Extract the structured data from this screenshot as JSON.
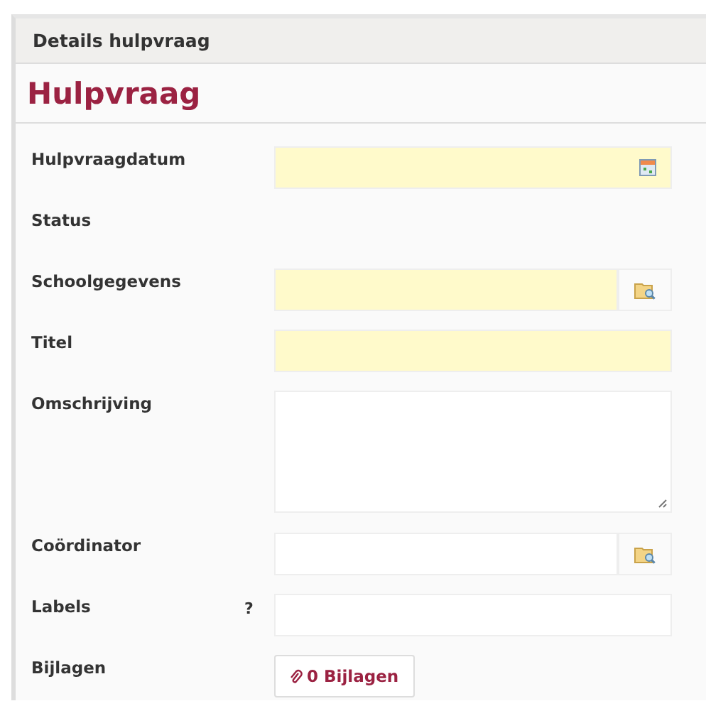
{
  "panel": {
    "title": "Details hulpvraag"
  },
  "section": {
    "title": "Hulpvraag"
  },
  "fields": [
    {
      "label": "Hulpvraagdatum",
      "kind": "date",
      "required": true
    },
    {
      "label": "Status",
      "kind": "static"
    },
    {
      "label": "Schoolgegevens",
      "kind": "lookup",
      "required": true
    },
    {
      "label": "Titel",
      "kind": "text",
      "required": true
    },
    {
      "label": "Omschrijving",
      "kind": "textarea",
      "required": false
    },
    {
      "label": "Coördinator",
      "kind": "lookup",
      "required": false
    },
    {
      "label": "Labels",
      "kind": "text",
      "required": false,
      "help": "?"
    },
    {
      "label": "Bijlagen",
      "kind": "attachments",
      "button": "0 Bijlagen"
    }
  ]
}
